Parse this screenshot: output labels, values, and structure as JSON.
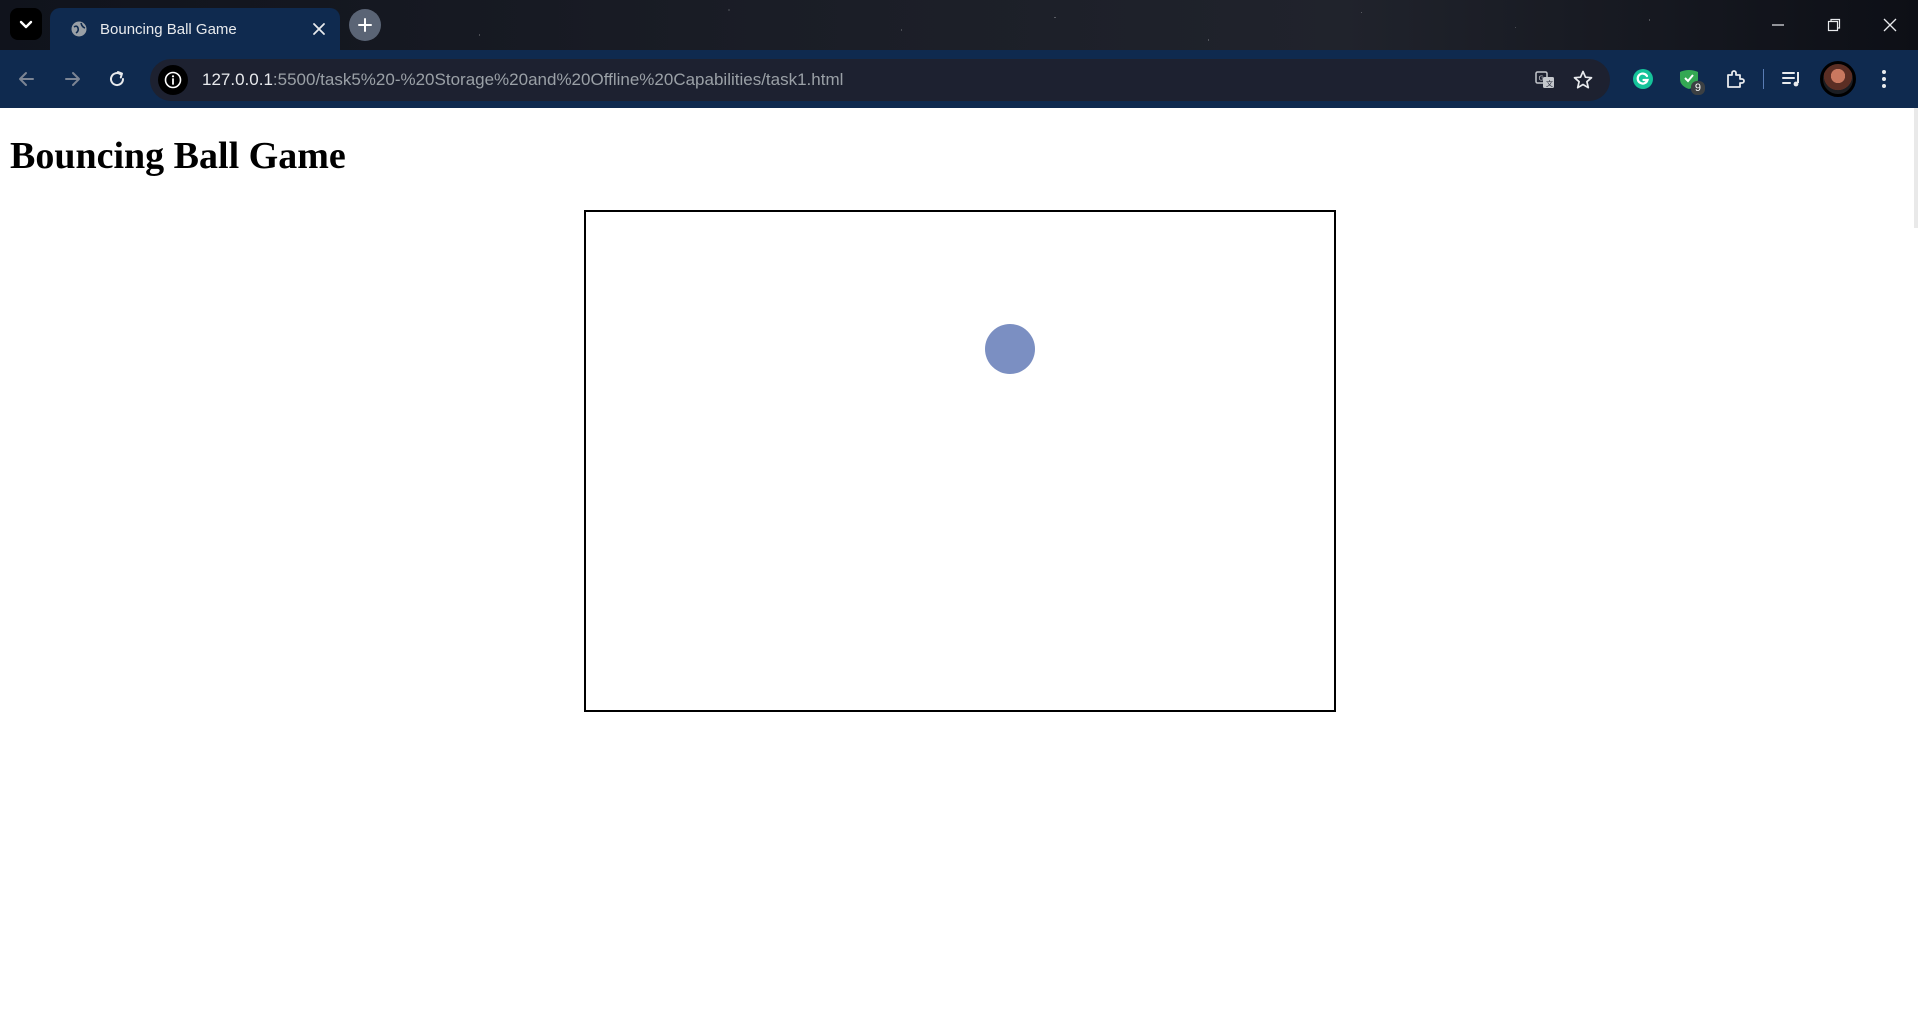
{
  "browser": {
    "tab": {
      "title": "Bouncing Ball Game",
      "favicon": "globe-icon"
    },
    "address_bar": {
      "host": "127.0.0.1",
      "path": ":5500/task5%20-%20Storage%20and%20Offline%20Capabilities/task1.html"
    },
    "extensions": [
      {
        "name": "grammarly-icon"
      },
      {
        "name": "shield-extension-icon",
        "badge": "9"
      },
      {
        "name": "puzzle-icon"
      }
    ],
    "colors": {
      "toolbar": "#0f2a4f",
      "omnibox": "#1d2130"
    }
  },
  "page": {
    "heading": "Bouncing Ball Game",
    "game": {
      "ball_color": "#7b8fc2",
      "border_color": "#000000"
    }
  }
}
